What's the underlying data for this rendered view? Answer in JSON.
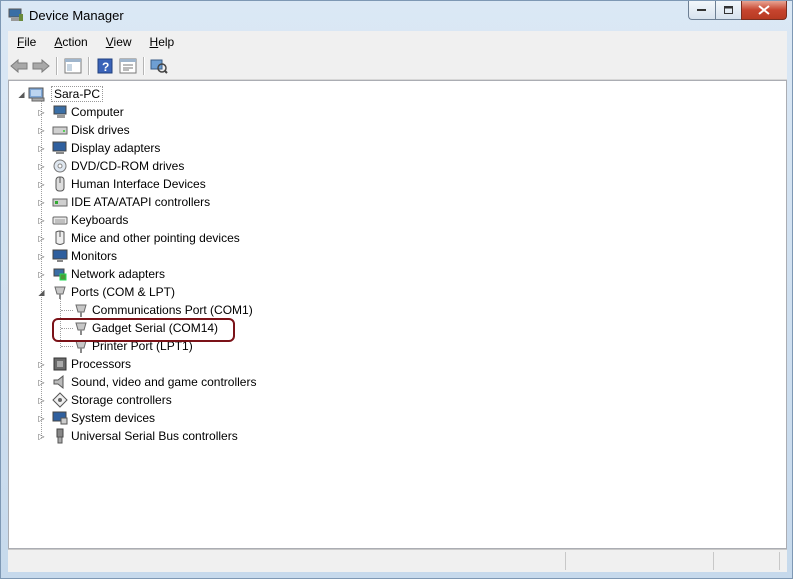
{
  "window": {
    "title": "Device Manager"
  },
  "menu": [
    {
      "label_pre": "",
      "label_ul": "F",
      "label_post": "ile"
    },
    {
      "label_pre": "",
      "label_ul": "A",
      "label_post": "ction"
    },
    {
      "label_pre": "",
      "label_ul": "V",
      "label_post": "iew"
    },
    {
      "label_pre": "",
      "label_ul": "H",
      "label_post": "elp"
    }
  ],
  "tree": {
    "root": "Sara-PC",
    "categories": [
      "Computer",
      "Disk drives",
      "Display adapters",
      "DVD/CD-ROM drives",
      "Human Interface Devices",
      "IDE ATA/ATAPI controllers",
      "Keyboards",
      "Mice and other pointing devices",
      "Monitors",
      "Network adapters",
      "Ports (COM & LPT)",
      "Processors",
      "Sound, video and game controllers",
      "Storage controllers",
      "System devices",
      "Universal Serial Bus controllers"
    ],
    "ports_children": [
      "Communications Port (COM1)",
      "Gadget Serial (COM14)",
      "Printer Port (LPT1)"
    ]
  },
  "colors": {
    "highlight": "#7b1218"
  }
}
